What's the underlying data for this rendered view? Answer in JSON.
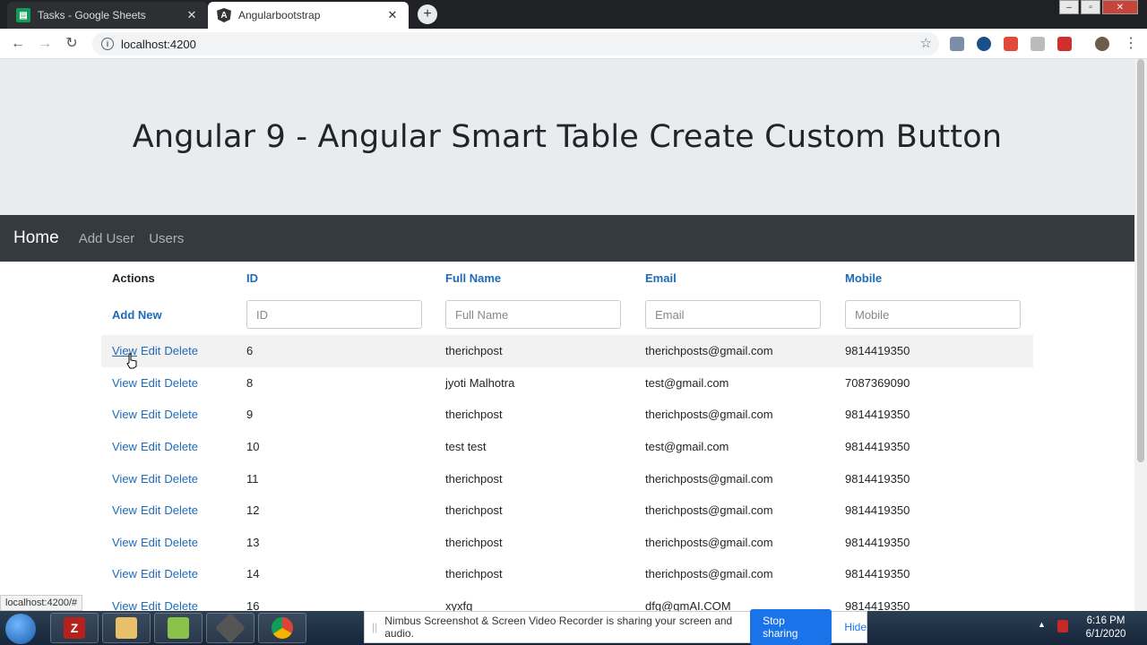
{
  "browser": {
    "tabs": [
      {
        "title": "Tasks - Google Sheets",
        "active": false
      },
      {
        "title": "Angularbootstrap",
        "active": true
      }
    ],
    "url": "localhost:4200",
    "status_url": "localhost:4200/#"
  },
  "page": {
    "heading": "Angular 9 - Angular Smart Table Create Custom Button",
    "navbar": {
      "brand": "Home",
      "links": [
        "Add User",
        "Users"
      ]
    },
    "table": {
      "headers": {
        "actions": "Actions",
        "id": "ID",
        "full_name": "Full Name",
        "email": "Email",
        "mobile": "Mobile"
      },
      "add_new": "Add New",
      "filters": {
        "id": "ID",
        "full_name": "Full Name",
        "email": "Email",
        "mobile": "Mobile"
      },
      "action_labels": {
        "view": "View",
        "edit": "Edit",
        "delete": "Delete"
      },
      "rows": [
        {
          "id": "6",
          "full_name": "therichpost",
          "email": "therichposts@gmail.com",
          "mobile": "9814419350"
        },
        {
          "id": "8",
          "full_name": "jyoti Malhotra",
          "email": "test@gmail.com",
          "mobile": "7087369090"
        },
        {
          "id": "9",
          "full_name": "therichpost",
          "email": "therichposts@gmail.com",
          "mobile": "9814419350"
        },
        {
          "id": "10",
          "full_name": "test test",
          "email": "test@gmail.com",
          "mobile": "9814419350"
        },
        {
          "id": "11",
          "full_name": "therichpost",
          "email": "therichposts@gmail.com",
          "mobile": "9814419350"
        },
        {
          "id": "12",
          "full_name": "therichpost",
          "email": "therichposts@gmail.com",
          "mobile": "9814419350"
        },
        {
          "id": "13",
          "full_name": "therichpost",
          "email": "therichposts@gmail.com",
          "mobile": "9814419350"
        },
        {
          "id": "14",
          "full_name": "therichpost",
          "email": "therichposts@gmail.com",
          "mobile": "9814419350"
        },
        {
          "id": "16",
          "full_name": "xyxfg",
          "email": "dfg@gmAI.COM",
          "mobile": "9814419350"
        }
      ]
    }
  },
  "nimbus_bar": {
    "message": "Nimbus Screenshot & Screen Video Recorder is sharing your screen and audio.",
    "stop_label": "Stop sharing",
    "hide_label": "Hide"
  },
  "taskbar": {
    "time": "6:16 PM",
    "date": "6/1/2020"
  },
  "colors": {
    "link": "#1e6bb8",
    "navbar_bg": "#343a40",
    "jumbotron_bg": "#e9ecef",
    "highlight_row": "#f2f2f2"
  }
}
